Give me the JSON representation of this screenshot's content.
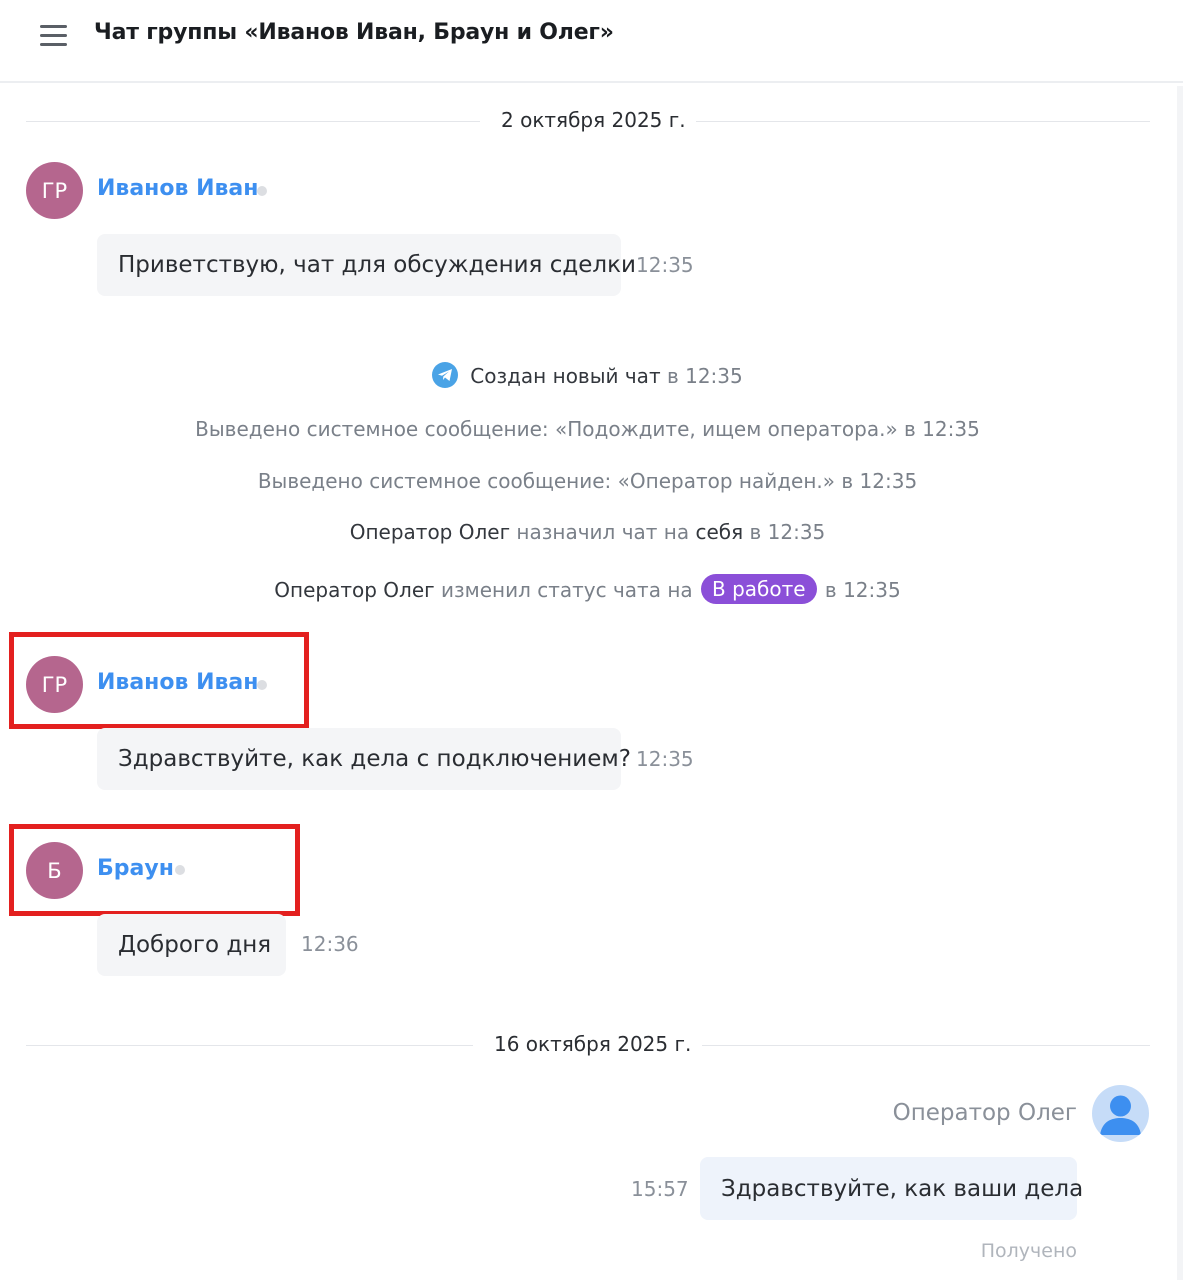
{
  "header": {
    "menu_icon": "hamburger-menu-icon",
    "title": "Чат группы «Иванов Иван, Браун и Олег»"
  },
  "dates": {
    "first": "2 октября 2025 г.",
    "second": "16 октября 2025 г."
  },
  "messages": [
    {
      "initials": "ГР",
      "sender": "Иванов Иван",
      "text": "Приветствую, чат для обсуждения сделки",
      "time": "12:35"
    },
    {
      "initials": "ГР",
      "sender": "Иванов Иван",
      "text": "Здравствуйте, как дела с подключением?",
      "time": "12:35"
    },
    {
      "initials": "Б",
      "sender": "Браун",
      "text": "Доброго дня",
      "time": "12:36"
    }
  ],
  "system": {
    "created": {
      "icon": "telegram-icon",
      "strong": "Создан новый чат",
      "suffix": " в 12:35"
    },
    "msg1": "Выведено системное сообщение: «Подождите, ищем оператора.» в 12:35",
    "msg2": "Выведено системное сообщение: «Оператор найден.» в 12:35",
    "assign": {
      "who": "Оператор Олег",
      "action": " назначил чат на ",
      "target": "себя",
      "suffix": " в 12:35"
    },
    "status": {
      "who": "Оператор Олег",
      "action": " изменил статус чата на ",
      "badge": "В работе",
      "suffix": " в 12:35",
      "badge_color": "#8b4fd8"
    }
  },
  "outgoing": {
    "operator_name": "Оператор Олег",
    "avatar_icon": "user-avatar-icon",
    "text": "Здравствуйте, как ваши дела",
    "time": "15:57",
    "status": "Получено"
  },
  "colors": {
    "sender_name": "#3d8ff0",
    "avatar": "#b5668e",
    "highlight": "#e3201f"
  }
}
